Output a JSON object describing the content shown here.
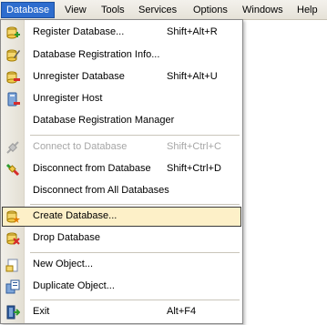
{
  "menubar": {
    "items": [
      {
        "label": "Database",
        "active": true
      },
      {
        "label": "View"
      },
      {
        "label": "Tools"
      },
      {
        "label": "Services"
      },
      {
        "label": "Options"
      },
      {
        "label": "Windows"
      },
      {
        "label": "Help"
      }
    ]
  },
  "menu": {
    "items": [
      {
        "label": "Register Database...",
        "shortcut": "Shift+Alt+R",
        "icon": "register-database-icon"
      },
      {
        "label": "Database Registration Info...",
        "shortcut": "",
        "icon": "registration-info-icon"
      },
      {
        "label": "Unregister Database",
        "shortcut": "Shift+Alt+U",
        "icon": "unregister-database-icon"
      },
      {
        "label": "Unregister Host",
        "shortcut": "",
        "icon": "unregister-host-icon"
      },
      {
        "label": "Database Registration Manager",
        "shortcut": "",
        "icon": ""
      },
      {
        "label": "Connect to Database",
        "shortcut": "Shift+Ctrl+C",
        "icon": "connect-icon",
        "disabled": true
      },
      {
        "label": "Disconnect from Database",
        "shortcut": "Shift+Ctrl+D",
        "icon": "disconnect-icon"
      },
      {
        "label": "Disconnect from All Databases",
        "shortcut": "",
        "icon": ""
      },
      {
        "label": "Create Database...",
        "shortcut": "",
        "icon": "create-database-icon",
        "highlighted": true
      },
      {
        "label": "Drop Database",
        "shortcut": "",
        "icon": "drop-database-icon"
      },
      {
        "label": "New Object...",
        "shortcut": "",
        "icon": "new-object-icon"
      },
      {
        "label": "Duplicate Object...",
        "shortcut": "",
        "icon": "duplicate-object-icon"
      },
      {
        "label": "Exit",
        "shortcut": "Alt+F4",
        "icon": "exit-icon"
      }
    ]
  },
  "colors": {
    "highlight_bg": "#fdf0c8",
    "active_menubar": "#2e6dce",
    "disabled_text": "#a6a6a6"
  }
}
